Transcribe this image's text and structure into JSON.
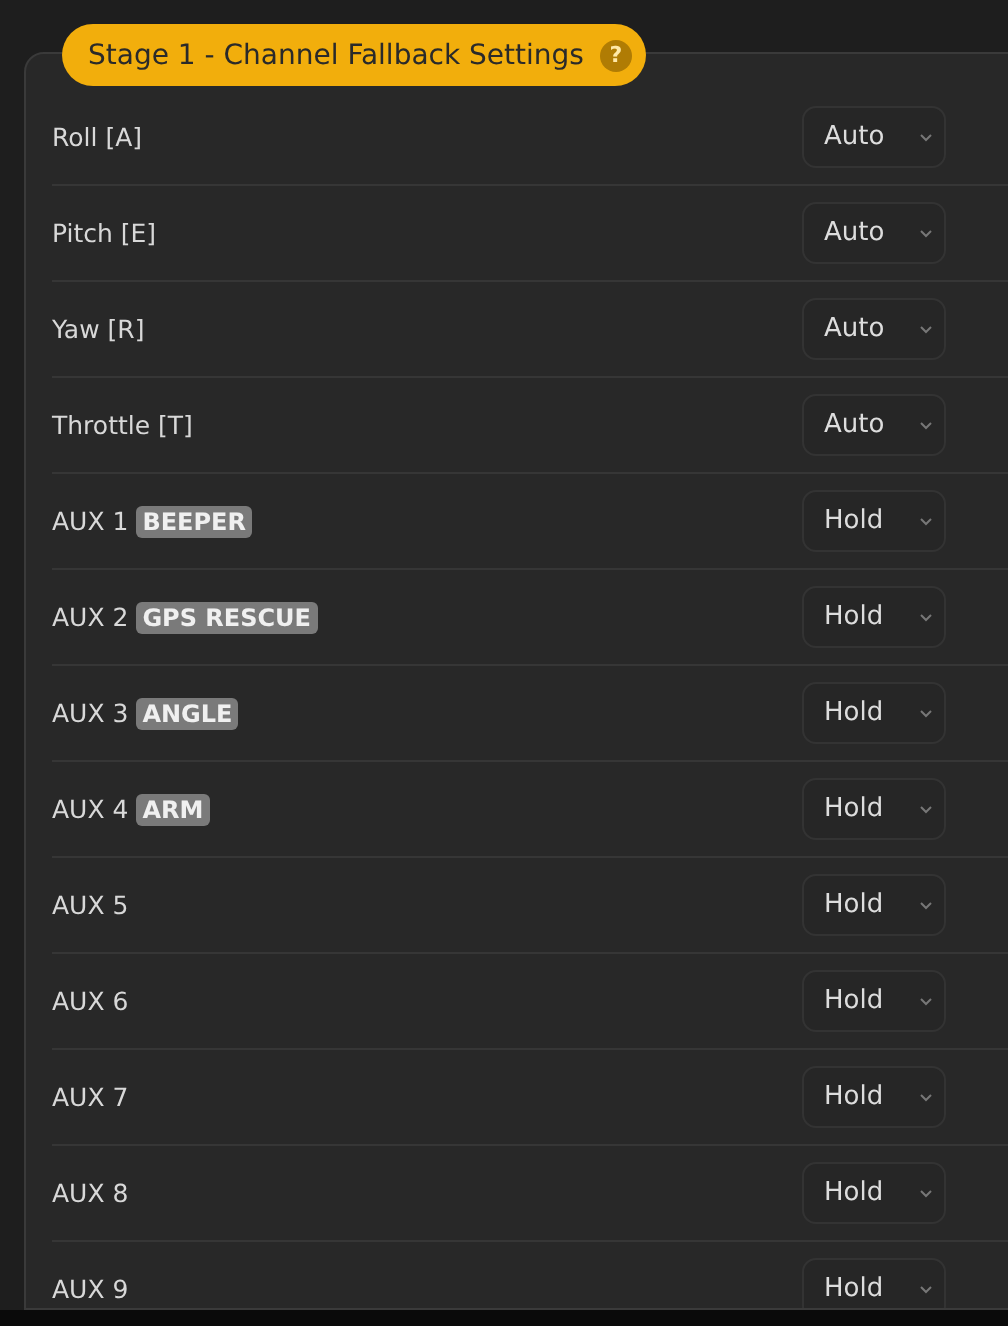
{
  "panel": {
    "title": "Stage 1 - Channel Fallback Settings",
    "help": "?"
  },
  "channels": [
    {
      "label": "Roll [A]",
      "value": "Auto"
    },
    {
      "label": "Pitch [E]",
      "value": "Auto"
    },
    {
      "label": "Yaw [R]",
      "value": "Auto"
    },
    {
      "label": "Throttle [T]",
      "value": "Auto"
    },
    {
      "label": "AUX 1",
      "mode": "BEEPER",
      "value": "Hold"
    },
    {
      "label": "AUX 2",
      "mode": "GPS RESCUE",
      "value": "Hold"
    },
    {
      "label": "AUX 3",
      "mode": "ANGLE",
      "value": "Hold"
    },
    {
      "label": "AUX 4",
      "mode": "ARM",
      "value": "Hold"
    },
    {
      "label": "AUX 5",
      "value": "Hold"
    },
    {
      "label": "AUX 6",
      "value": "Hold"
    },
    {
      "label": "AUX 7",
      "value": "Hold"
    },
    {
      "label": "AUX 8",
      "value": "Hold"
    },
    {
      "label": "AUX 9",
      "value": "Hold"
    }
  ]
}
